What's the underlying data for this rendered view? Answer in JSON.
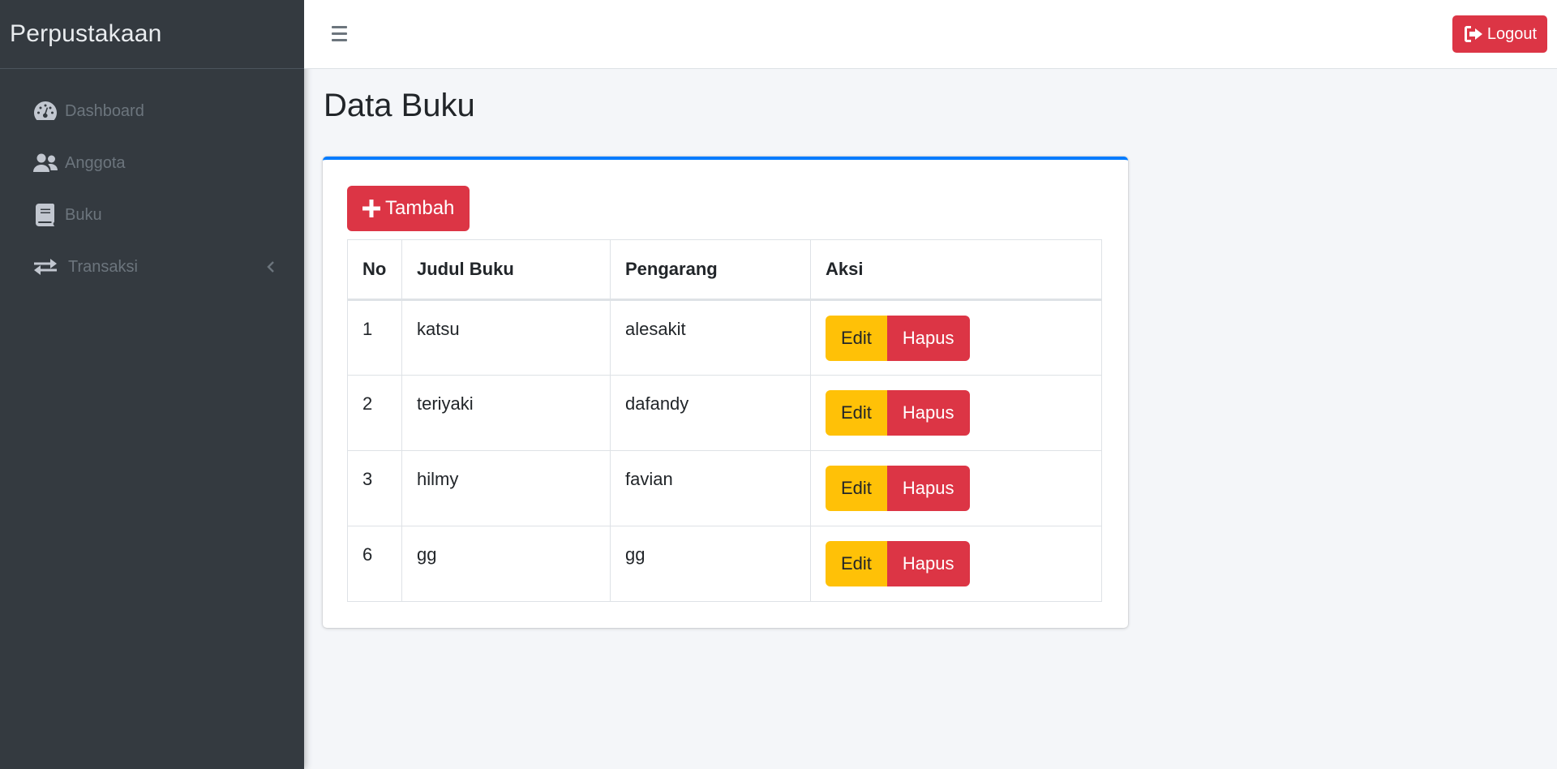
{
  "brand": {
    "title": "Perpustakaan"
  },
  "sidebar": {
    "items": [
      {
        "label": "Dashboard",
        "icon": "tachometer-icon"
      },
      {
        "label": "Anggota",
        "icon": "users-icon"
      },
      {
        "label": "Buku",
        "icon": "book-icon"
      },
      {
        "label": "Transaksi",
        "icon": "exchange-icon",
        "caret": "chevron-left-icon"
      }
    ]
  },
  "topbar": {
    "menu_icon": "hamburger-icon",
    "logout_label": "Logout"
  },
  "main": {
    "page_title": "Data Buku",
    "add_label": "Tambah",
    "table": {
      "headers": [
        "No",
        "Judul Buku",
        "Pengarang",
        "Aksi"
      ],
      "rows": [
        {
          "no": "1",
          "judul": "katsu",
          "pengarang": "alesakit"
        },
        {
          "no": "2",
          "judul": "teriyaki",
          "pengarang": "dafandy"
        },
        {
          "no": "3",
          "judul": "hilmy",
          "pengarang": "favian"
        },
        {
          "no": "6",
          "judul": "gg",
          "pengarang": "gg"
        }
      ],
      "edit_label": "Edit",
      "hapus_label": "Hapus"
    }
  },
  "colors": {
    "sidebar_bg": "#343a40",
    "primary": "#007bff",
    "danger": "#dc3545",
    "warning": "#ffc107",
    "content_bg": "#f4f6f9"
  }
}
